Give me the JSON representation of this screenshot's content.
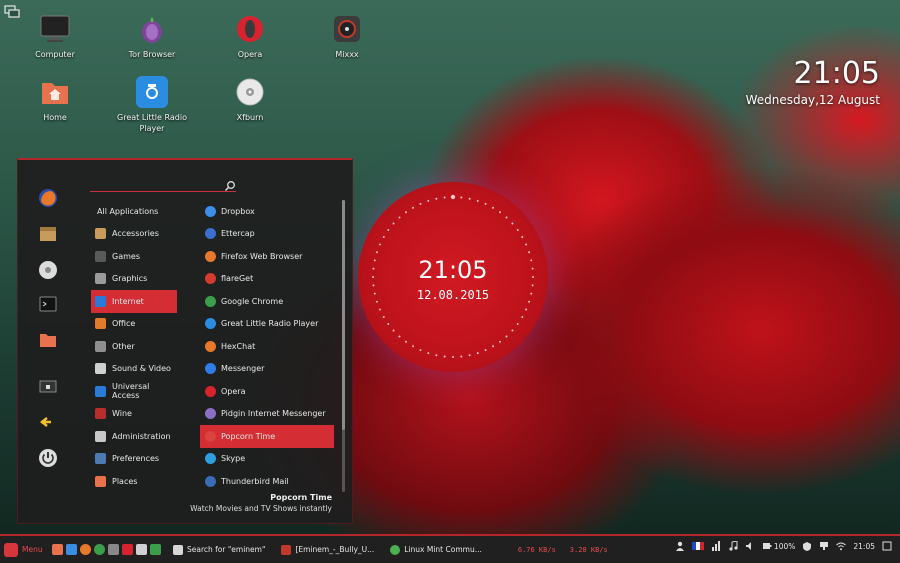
{
  "desktop": {
    "icons": [
      {
        "label": "Computer",
        "icon": "monitor-icon"
      },
      {
        "label": "Tor Browser",
        "icon": "onion-icon"
      },
      {
        "label": "Opera",
        "icon": "opera-icon"
      },
      {
        "label": "Mixxx",
        "icon": "dj-mixer-icon"
      },
      {
        "label": "Home",
        "icon": "home-folder-icon"
      },
      {
        "label": "Great Little Radio Player",
        "icon": "radio-icon"
      },
      {
        "label": "Xfburn",
        "icon": "disc-icon"
      }
    ]
  },
  "clock_widget": {
    "time": "21:05",
    "date": "Wednesday,12 August"
  },
  "round_clock": {
    "time": "21:05",
    "date": "12.08.2015"
  },
  "menu": {
    "search_placeholder": "",
    "sidebar": [
      "firefox-icon",
      "package-icon",
      "disc-icon",
      "terminal-icon",
      "folder-icon",
      "lock-screen-icon",
      "logout-icon",
      "power-icon"
    ],
    "categories": [
      {
        "label": "All Applications",
        "color": ""
      },
      {
        "label": "Accessories",
        "color": "#c89b5c"
      },
      {
        "label": "Games",
        "color": "#5a5a5a"
      },
      {
        "label": "Graphics",
        "color": "#9a9a9a"
      },
      {
        "label": "Internet",
        "color": "#2a7bd8"
      },
      {
        "label": "Office",
        "color": "#e07b2e"
      },
      {
        "label": "Other",
        "color": "#8f8f8f"
      },
      {
        "label": "Sound & Video",
        "color": "#d0d0d0"
      },
      {
        "label": "Universal Access",
        "color": "#2a7bd8"
      },
      {
        "label": "Wine",
        "color": "#b82e2e"
      },
      {
        "label": "Administration",
        "color": "#c8c8c8"
      },
      {
        "label": "Preferences",
        "color": "#4d7ab3"
      },
      {
        "label": "Places",
        "color": "#e8724e"
      }
    ],
    "active_category": "Internet",
    "apps": [
      {
        "label": "Dropbox",
        "color": "#3d8ee8"
      },
      {
        "label": "Ettercap",
        "color": "#3c6fcf"
      },
      {
        "label": "Firefox Web Browser",
        "color": "#e8792b"
      },
      {
        "label": "flareGet",
        "color": "#d63b2f"
      },
      {
        "label": "Google Chrome",
        "color": "#3a9f4a"
      },
      {
        "label": "Great Little Radio Player",
        "color": "#2b8de0"
      },
      {
        "label": "HexChat",
        "color": "#e87826"
      },
      {
        "label": "Messenger",
        "color": "#2d7ee8"
      },
      {
        "label": "Opera",
        "color": "#d8232f"
      },
      {
        "label": "Pidgin Internet Messenger",
        "color": "#8a6fc4"
      },
      {
        "label": "Popcorn Time",
        "color": "#d9443c"
      },
      {
        "label": "Skype",
        "color": "#2d9fe0"
      },
      {
        "label": "Thunderbird Mail",
        "color": "#3a6bb5"
      }
    ],
    "active_app": "Popcorn Time",
    "selected_app_description": {
      "name": "Popcorn Time",
      "text": "Watch Movies and TV Shows instantly"
    }
  },
  "taskbar": {
    "menu_label": "Menu",
    "tasks": [
      {
        "label": "Search for \"eminem\"",
        "color": "#d6d6d6"
      },
      {
        "label": "[Eminem_-_Bully_U...",
        "color": "#c0392b"
      },
      {
        "label": "Linux Mint Commu...",
        "color": "#4caf50"
      }
    ],
    "net_down": "6.76 KB/s",
    "net_up": "3.28 KB/s",
    "battery": "100%",
    "time": "21:05"
  }
}
